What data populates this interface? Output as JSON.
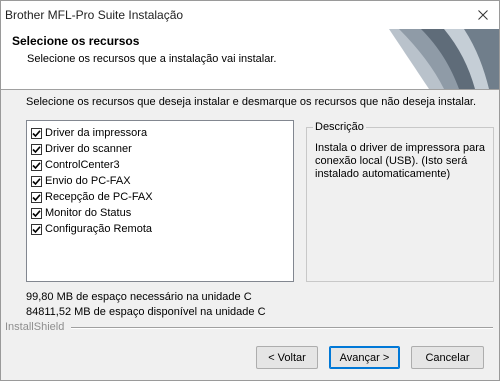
{
  "window": {
    "title": "Brother MFL-Pro Suite Instalação"
  },
  "header": {
    "title": "Selecione os recursos",
    "subtitle": "Selecione os recursos que a instalação vai instalar."
  },
  "instruction": "Selecione os recursos que deseja instalar e desmarque os recursos que não deseja instalar.",
  "features": [
    {
      "label": "Driver da impressora",
      "checked": true
    },
    {
      "label": "Driver do scanner",
      "checked": true
    },
    {
      "label": "ControlCenter3",
      "checked": true
    },
    {
      "label": "Envio do PC-FAX",
      "checked": true
    },
    {
      "label": "Recepção de PC-FAX",
      "checked": true
    },
    {
      "label": "Monitor do Status",
      "checked": true
    },
    {
      "label": "Configuração Remota",
      "checked": true
    }
  ],
  "description": {
    "legend": "Descrição",
    "text": "Instala o driver de impressora para conexão local (USB). (Isto será instalado automaticamente)"
  },
  "space": {
    "required": "99,80 MB de espaço necessário na unidade C",
    "available": "84811,52 MB de espaço disponível na unidade C"
  },
  "footer": {
    "brand": "InstallShield"
  },
  "buttons": {
    "back": "< Voltar",
    "next": "Avançar >",
    "cancel": "Cancelar"
  }
}
